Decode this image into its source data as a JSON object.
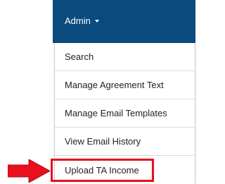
{
  "navbar": {
    "admin_label": "Admin",
    "background_color": "#0b4a7d"
  },
  "dropdown": {
    "items": [
      {
        "label": "Search"
      },
      {
        "label": "Manage Agreement Text"
      },
      {
        "label": "Manage Email Templates"
      },
      {
        "label": "View Email History"
      },
      {
        "label": "Upload TA Income"
      }
    ],
    "highlighted_item": "Upload TA Income"
  },
  "annotation": {
    "highlight_color": "#e8101c",
    "arrow_icon": "right-arrow-icon"
  }
}
